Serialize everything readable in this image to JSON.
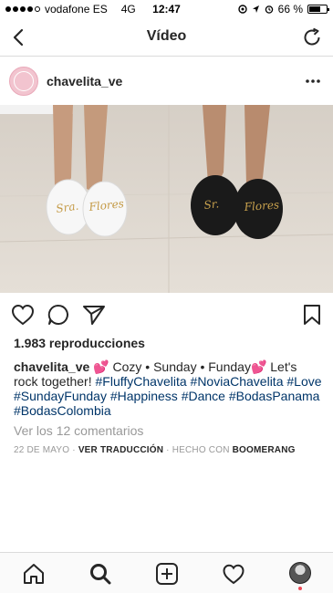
{
  "status_bar": {
    "carrier": "vodafone ES",
    "network": "4G",
    "time": "12:47",
    "battery": "66 %",
    "battery_level": 0.66,
    "signal_bars_filled": 4,
    "signal_bars_total": 5
  },
  "nav": {
    "title": "Vídeo",
    "back_icon": "chevron-left-icon",
    "refresh_icon": "refresh-icon"
  },
  "post": {
    "username": "chavelita_ve",
    "media_texts": {
      "left_slipper": "Sra. Flores",
      "right_slipper": "Sr. Flores"
    },
    "views": "1.983 reproducciones",
    "caption_username": "chavelita_ve",
    "caption_text_1": " 💕 Cozy • Sunday • Funday💕  Let's rock together! ",
    "hashtags": [
      "#FluffyChavelita",
      "#NoviaChavelita",
      "#Love",
      "#SundayFunday",
      "#Happiness",
      "#Dance",
      "#BodasPanama",
      "#BodasColombia"
    ],
    "comments_link": "Ver los 12 comentarios",
    "date": "22 DE MAYO",
    "translate": "VER TRADUCCIÓN",
    "made_with_prefix": "HECHO CON",
    "made_with_app": "BOOMERANG"
  },
  "colors": {
    "text": "#262626",
    "muted": "#999999",
    "hashtag": "#003569",
    "border": "#dbdbdb",
    "notification": "#ed4956"
  },
  "tab_icons": [
    "home-icon",
    "search-icon",
    "add-post-icon",
    "heart-icon",
    "profile-avatar"
  ]
}
